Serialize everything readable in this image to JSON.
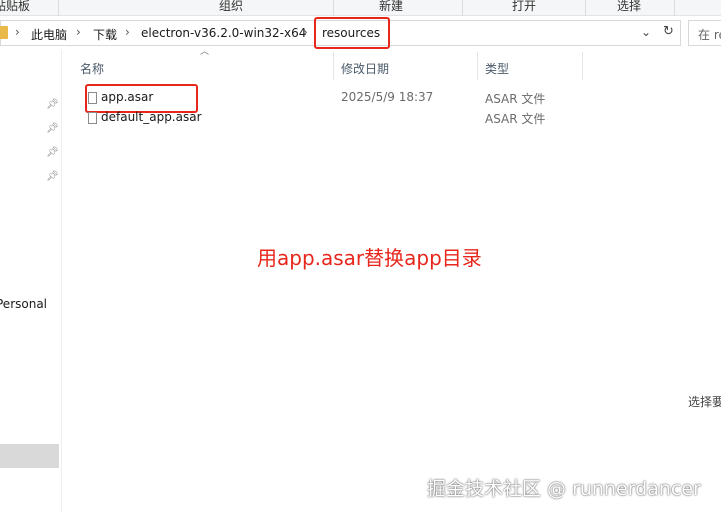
{
  "ribbon": {
    "groups": [
      "贴贴板",
      "组织",
      "新建",
      "打开",
      "选择"
    ]
  },
  "address_bar": {
    "crumbs": [
      "此电脑",
      "下载",
      "electron-v36.2.0-win32-x64",
      "resources"
    ],
    "separator": "›",
    "dropdown_icon": "chevron-down-icon",
    "refresh_icon": "refresh-icon"
  },
  "search": {
    "placeholder": "在 re"
  },
  "nav": {
    "pin_icon": "pin-icon",
    "item_personal": "Personal"
  },
  "columns": {
    "name": "名称",
    "modified": "修改日期",
    "type": "类型"
  },
  "files": [
    {
      "name": "app.asar",
      "modified": "2025/5/9 18:37",
      "type": "ASAR 文件"
    },
    {
      "name": "default_app.asar",
      "modified": "",
      "type": "ASAR 文件"
    }
  ],
  "annotation": "用app.asar替换app目录",
  "details_pane_text": "选择要",
  "watermark": "掘金技术社区 @ runnerdancer",
  "colors": {
    "highlight_red": "#e8271c",
    "folder_yellow": "#e9b949"
  }
}
